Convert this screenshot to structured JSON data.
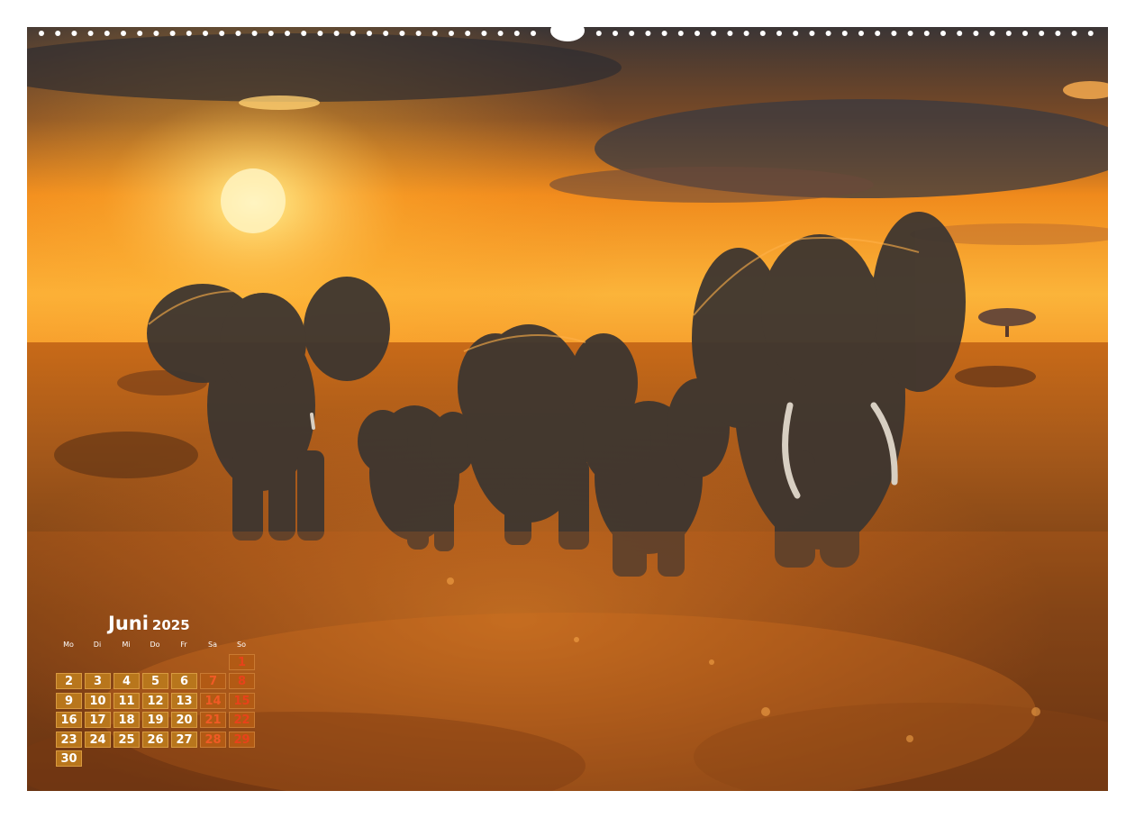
{
  "calendar": {
    "month": "Juni",
    "year": "2025",
    "weekdays": [
      "Mo",
      "Di",
      "Mi",
      "Do",
      "Fr",
      "Sa",
      "So"
    ],
    "first_weekday_index": 6,
    "days": [
      "1",
      "2",
      "3",
      "4",
      "5",
      "6",
      "7",
      "8",
      "9",
      "10",
      "11",
      "12",
      "13",
      "14",
      "15",
      "16",
      "17",
      "18",
      "19",
      "20",
      "21",
      "22",
      "23",
      "24",
      "25",
      "26",
      "27",
      "28",
      "29",
      "30"
    ],
    "colors": {
      "weekday_fill": "#b8761c",
      "weekend_text": "#e8421a",
      "text": "#ffffff"
    }
  }
}
